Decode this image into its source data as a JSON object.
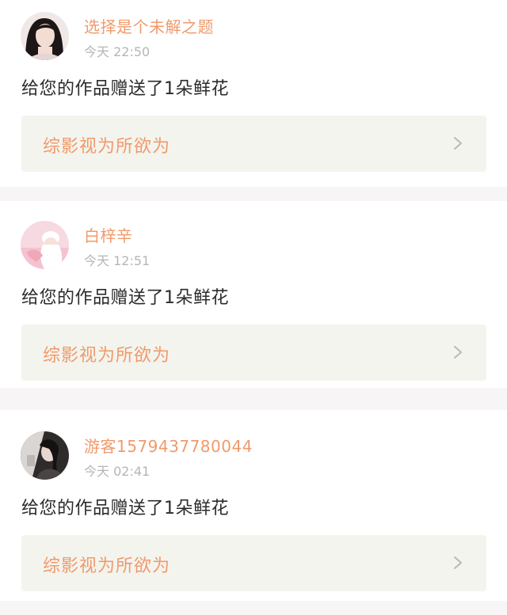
{
  "notifications": [
    {
      "user_name": "选择是个未解之题",
      "time": "今天 22:50",
      "message": "给您的作品赠送了1朵鲜花",
      "work_title": "综影视为所欲为",
      "avatar_icon": "avatar-dark-hair-girl"
    },
    {
      "user_name": "白梓辛",
      "time": "今天 12:51",
      "message": "给您的作品赠送了1朵鲜花",
      "work_title": "综影视为所欲为",
      "avatar_icon": "avatar-pink-cap-girl"
    },
    {
      "user_name": "游客1579437780044",
      "time": "今天 02:41",
      "message": "给您的作品赠送了1朵鲜花",
      "work_title": "综影视为所欲为",
      "avatar_icon": "avatar-dark-photo"
    }
  ],
  "colors": {
    "accent": "#f09a6c",
    "card_bg": "#ffffff",
    "link_bg": "#f4f4ee",
    "page_bg": "#f7f5f5",
    "time_text": "#b5b5b5",
    "body_text": "#2b2b2b"
  }
}
